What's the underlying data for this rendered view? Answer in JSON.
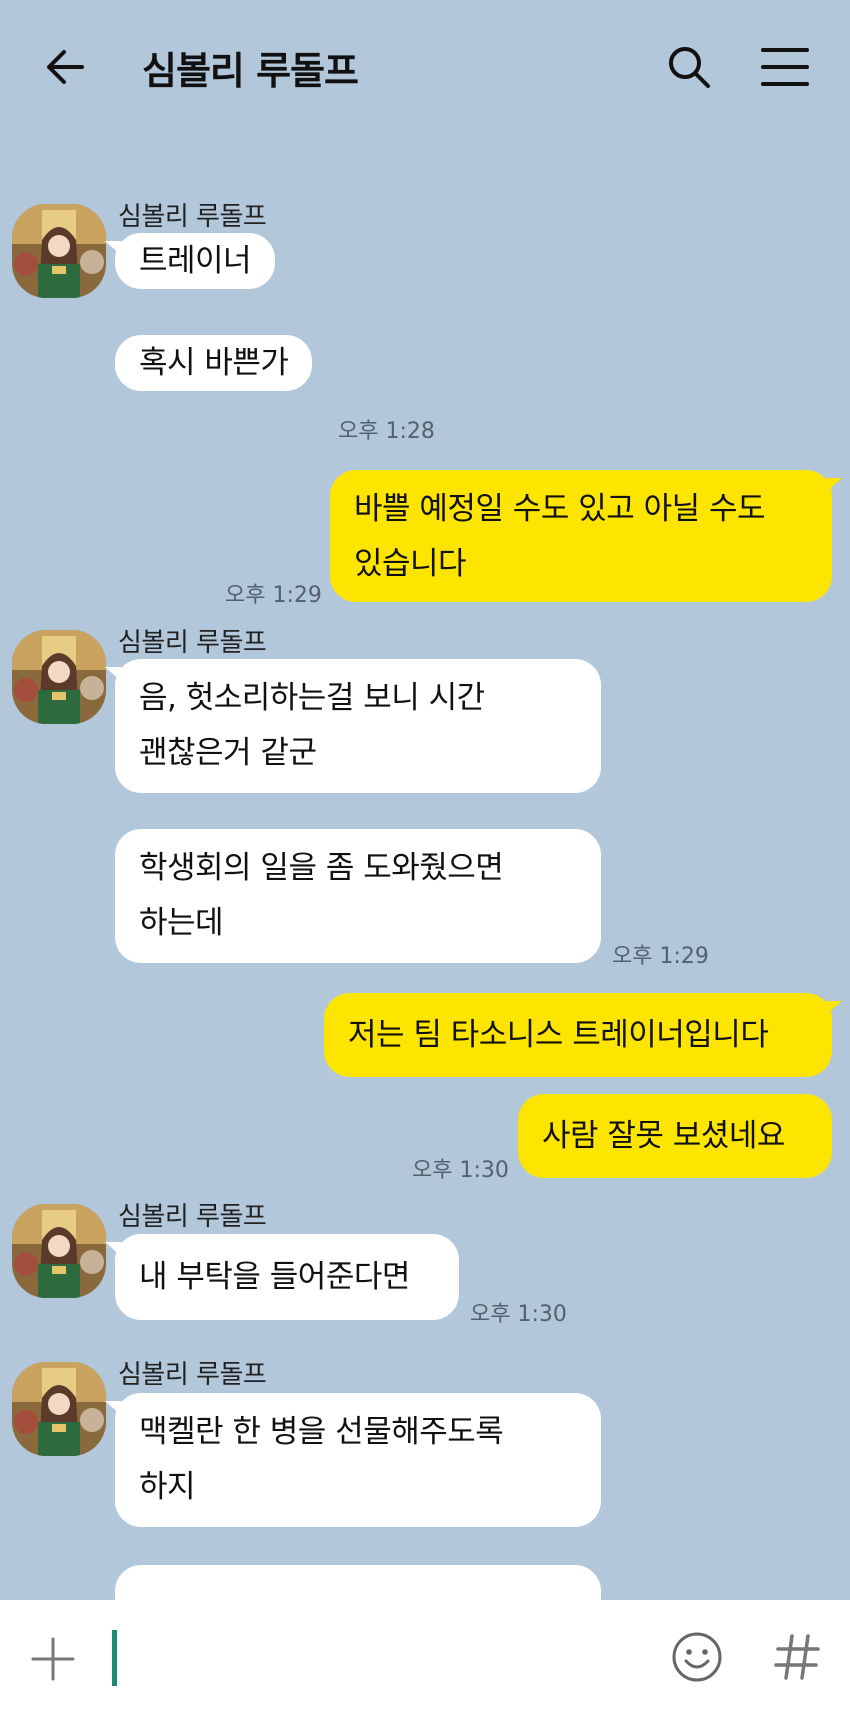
{
  "header": {
    "title": "심볼리 루돌프",
    "back_icon": "arrow-left-icon",
    "search_icon": "search-icon",
    "menu_icon": "hamburger-menu-icon"
  },
  "sender_name": "심볼리 루돌프",
  "messages": [
    {
      "side": "in",
      "lines": [
        "트레이너"
      ]
    },
    {
      "side": "in",
      "lines": [
        "혹시 바쁜가"
      ],
      "time": "오후 1:28"
    },
    {
      "side": "out",
      "lines": [
        "바쁠 예정일 수도 있고 아닐 수도",
        "있습니다"
      ],
      "time": "오후 1:29"
    },
    {
      "side": "in",
      "lines": [
        "음, 헛소리하는걸 보니 시간",
        "괜찮은거 같군"
      ]
    },
    {
      "side": "in",
      "lines": [
        "학생회의 일을 좀 도와줬으면",
        "하는데"
      ],
      "time": "오후 1:29"
    },
    {
      "side": "out",
      "lines": [
        "저는 팀 타소니스 트레이너입니다"
      ]
    },
    {
      "side": "out",
      "lines": [
        "사람 잘못 보셨네요"
      ],
      "time": "오후 1:30"
    },
    {
      "side": "in",
      "lines": [
        "내 부탁을 들어준다면"
      ],
      "time": "오후 1:30"
    },
    {
      "side": "in",
      "lines": [
        "맥켈란 한 병을 선물해주도록",
        "하지"
      ]
    }
  ],
  "input": {
    "value": "",
    "plus_icon": "plus-icon",
    "emoji_icon": "smiley-emoji-icon",
    "hash_icon": "hashtag-icon"
  },
  "colors": {
    "background": "#b2c7da",
    "incoming_bubble": "#ffffff",
    "outgoing_bubble": "#fee500",
    "caret": "#1f8a72"
  }
}
